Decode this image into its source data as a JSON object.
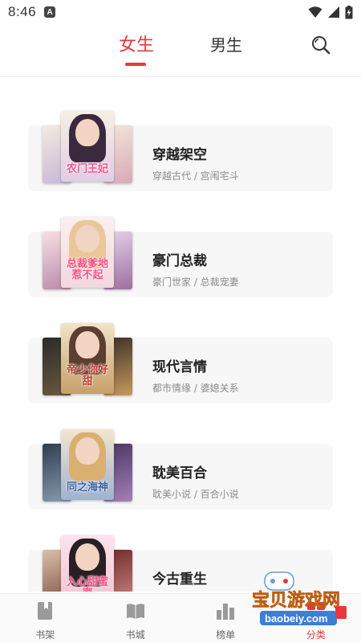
{
  "status_bar": {
    "time": "8:46",
    "notification_badge": "A"
  },
  "header": {
    "tabs": [
      {
        "label": "女生",
        "active": true
      },
      {
        "label": "男生",
        "active": false
      }
    ],
    "accent_color": "#e8383d",
    "search_icon": "search-icon"
  },
  "categories": [
    {
      "title": "穿越架空",
      "subtitle": "穿越古代 / 宫闱宅斗",
      "cover_text": "农门王妃",
      "cover_colors": [
        "#efe3d0",
        "#7a4f8c",
        "#d8c1a8"
      ]
    },
    {
      "title": "豪门总裁",
      "subtitle": "豪门世家 / 总裁宠妻",
      "cover_text": "总裁爹地惹不起",
      "cover_colors": [
        "#f6dde0",
        "#f2e6d5",
        "#c8a6c8"
      ]
    },
    {
      "title": "现代言情",
      "subtitle": "都市情缘 / 婆媳关系",
      "cover_text": "帝少你好甜",
      "cover_colors": [
        "#2a2a2a",
        "#d8b47a",
        "#3b2f2a"
      ]
    },
    {
      "title": "耽美百合",
      "subtitle": "耽美小说 / 百合小说",
      "cover_text": "同之海神",
      "cover_colors": [
        "#2f3f52",
        "#e8d3b5",
        "#5a3b6e"
      ]
    },
    {
      "title": "今古重生",
      "subtitle": "",
      "cover_text": "入心甜蜜蜜",
      "cover_colors": [
        "#d4b8a0",
        "#f4cfdc",
        "#6e2a2a"
      ]
    }
  ],
  "bottom_nav": [
    {
      "label": "书架",
      "icon": "bookshelf-icon",
      "active": false
    },
    {
      "label": "书城",
      "icon": "bookstore-icon",
      "active": false
    },
    {
      "label": "榜单",
      "icon": "ranking-icon",
      "active": false
    },
    {
      "label": "分类",
      "icon": "category-icon",
      "active": true
    }
  ],
  "watermark": {
    "text": "宝贝游戏网",
    "url_text": "baobeiy.com"
  }
}
